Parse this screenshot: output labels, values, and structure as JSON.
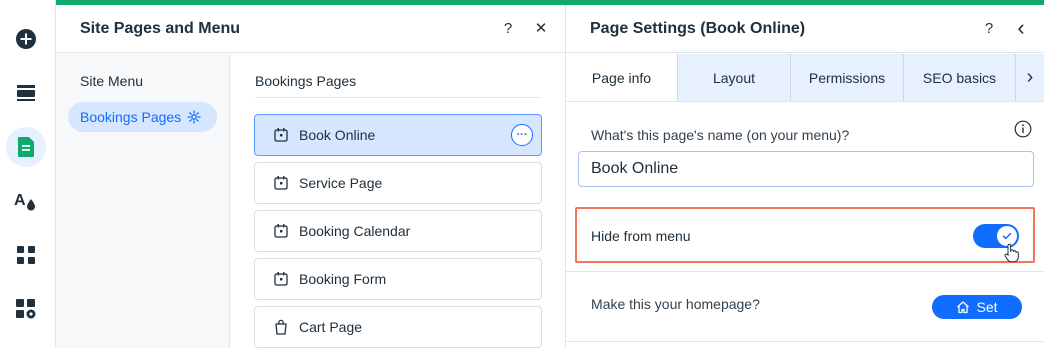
{
  "accent_color": "#0fa96b",
  "primary_color": "#116dff",
  "highlight_color": "#f0765a",
  "rail": {
    "items": [
      {
        "icon": "add-icon",
        "active": false
      },
      {
        "icon": "sections-icon",
        "active": false
      },
      {
        "icon": "pages-icon",
        "active": true
      },
      {
        "icon": "design-icon",
        "active": false
      },
      {
        "icon": "apps-icon",
        "active": false
      },
      {
        "icon": "business-apps-icon",
        "active": false
      }
    ]
  },
  "site_panel": {
    "title": "Site Pages and Menu",
    "help": "?",
    "close": "✕",
    "site_menu_label": "Site Menu",
    "selected_group": "Bookings Pages",
    "pages_title": "Bookings Pages",
    "more_label": "···",
    "pages": [
      {
        "label": "Book Online",
        "icon": "calendar-icon",
        "selected": true
      },
      {
        "label": "Service Page",
        "icon": "calendar-icon",
        "selected": false
      },
      {
        "label": "Booking Calendar",
        "icon": "calendar-icon",
        "selected": false
      },
      {
        "label": "Booking Form",
        "icon": "calendar-icon",
        "selected": false
      },
      {
        "label": "Cart Page",
        "icon": "shopping-bag-icon",
        "selected": false
      }
    ]
  },
  "settings_panel": {
    "title": "Page Settings (Book Online)",
    "help": "?",
    "back": "‹",
    "tabs": [
      {
        "label": "Page info",
        "active": true
      },
      {
        "label": "Layout",
        "active": false
      },
      {
        "label": "Permissions",
        "active": false
      },
      {
        "label": "SEO basics",
        "active": false
      }
    ],
    "tab_more": "›",
    "name_label": "What's this page's name (on your menu)?",
    "name_value": "Book Online",
    "hide_label": "Hide from menu",
    "hide_enabled": true,
    "homepage_label": "Make this your homepage?",
    "set_label": "Set"
  }
}
